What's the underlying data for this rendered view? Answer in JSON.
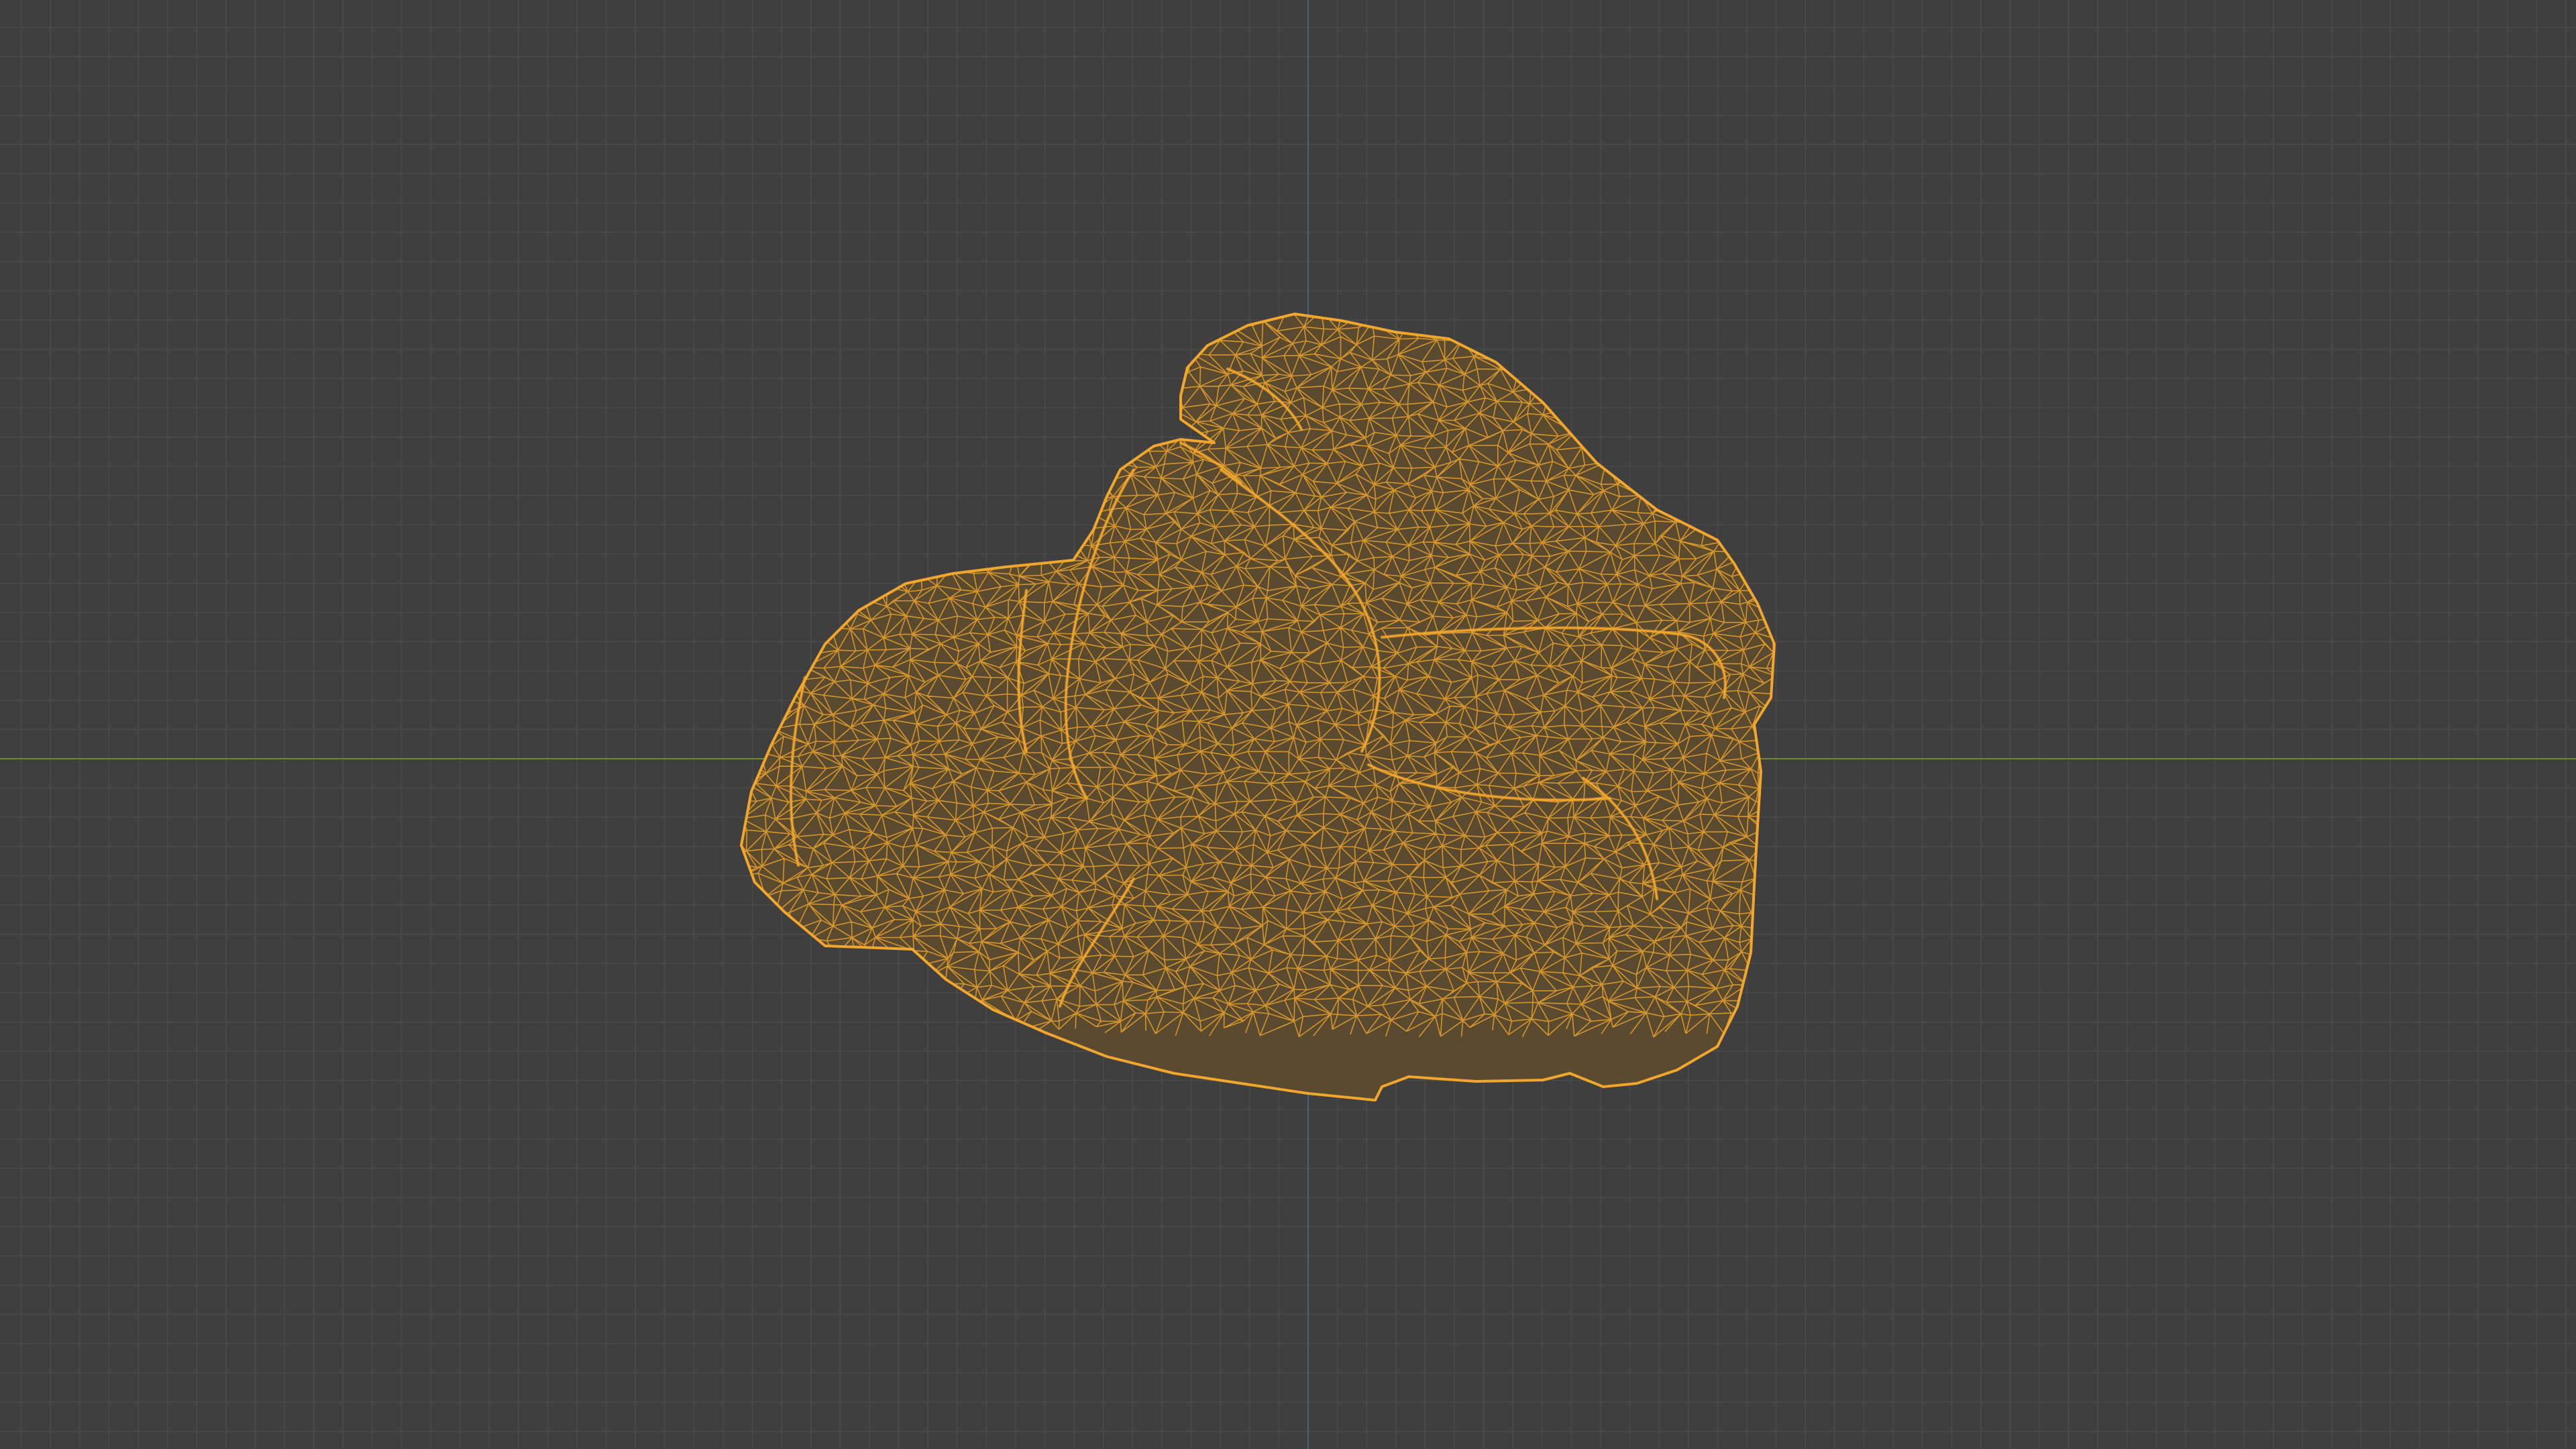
{
  "viewport": {
    "mode": "wireframe",
    "object_type": "rock mesh",
    "background_color": "#3f3f3f",
    "grid_line_color": "#4b4b4b",
    "x_axis_color": "#6e8a33",
    "y_axis_color": "#3f6580",
    "wireframe_color": "#f2a62c",
    "mesh_fill_color": "#5a4a2f"
  }
}
